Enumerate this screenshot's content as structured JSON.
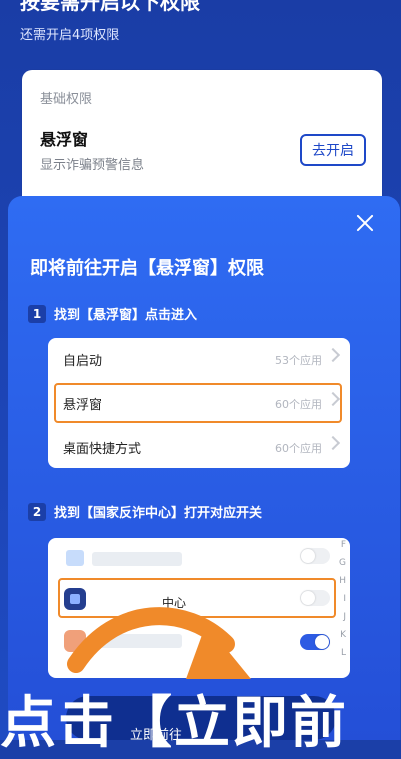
{
  "background": {
    "title": "按要需开启以下权限",
    "subtitle": "还需开启4项权限",
    "section_label": "基础权限",
    "item_title": "悬浮窗",
    "item_desc": "显示诈骗预警信息",
    "open_button": "去开启"
  },
  "sheet": {
    "title": "即将前往开启【悬浮窗】权限",
    "step1": {
      "num": "1",
      "text": "找到【悬浮窗】点击进入"
    },
    "list": [
      {
        "label": "自启动",
        "count": "53个应用"
      },
      {
        "label": "悬浮窗",
        "count": "60个应用"
      },
      {
        "label": "桌面快捷方式",
        "count": "60个应用"
      }
    ],
    "step2": {
      "num": "2",
      "text": "找到【国家反诈中心】打开对应开关"
    },
    "app_row_label": "中心",
    "alphabet": [
      "F",
      "G",
      "H",
      "I",
      "J",
      "K",
      "L"
    ],
    "close_icon": "close-icon"
  },
  "caption": {
    "big_text": "点击【立即前",
    "button_text": "立即前往"
  },
  "colors": {
    "primary": "#1f4bc2",
    "highlight": "#f08a2a"
  }
}
